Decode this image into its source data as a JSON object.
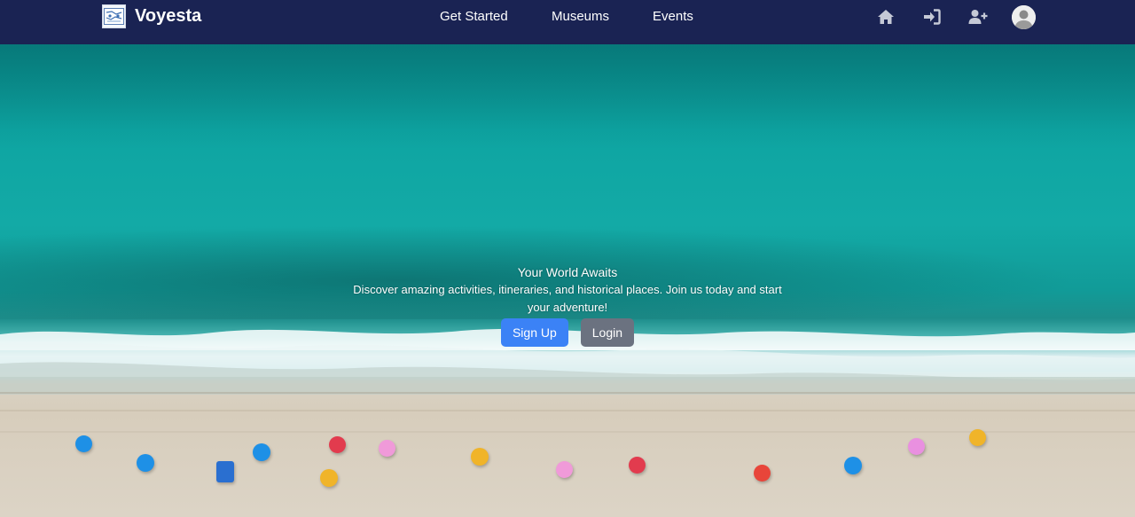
{
  "brand": {
    "name": "Voyesta",
    "logo_icon": "map-logo-icon"
  },
  "nav": {
    "links": [
      "Get Started",
      "Museums",
      "Events"
    ],
    "icons": [
      "home-icon",
      "sign-in-icon",
      "user-plus-icon"
    ],
    "avatar_icon": "user-avatar-icon"
  },
  "hero": {
    "title": "Your World Awaits",
    "description": "Discover amazing activities, itineraries, and historical places. Join us today and start your adventure!",
    "signup_label": "Sign Up",
    "login_label": "Login"
  },
  "colors": {
    "navbar": "#1a2353",
    "primary": "#3b82f6",
    "secondary": "#6b7280"
  }
}
